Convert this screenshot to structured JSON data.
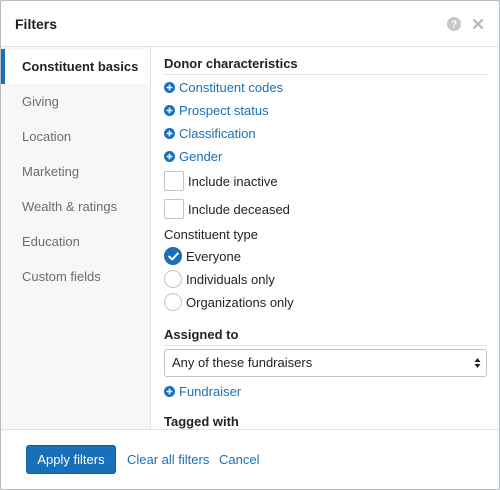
{
  "header": {
    "title": "Filters",
    "help_icon": "help-circle-icon",
    "close_icon": "close-icon"
  },
  "sidebar": {
    "items": [
      {
        "label": "Constituent basics",
        "active": true
      },
      {
        "label": "Giving"
      },
      {
        "label": "Location"
      },
      {
        "label": "Marketing"
      },
      {
        "label": "Wealth & ratings"
      },
      {
        "label": "Education"
      },
      {
        "label": "Custom fields"
      }
    ]
  },
  "content": {
    "donor_section_title": "Donor characteristics",
    "add_links": [
      {
        "label": "Constituent codes",
        "icon": "plus-circle-icon"
      },
      {
        "label": "Prospect status",
        "icon": "plus-circle-icon"
      },
      {
        "label": "Classification",
        "icon": "plus-circle-icon"
      },
      {
        "label": "Gender",
        "icon": "plus-circle-icon"
      }
    ],
    "checkboxes": [
      {
        "label": "Include inactive",
        "checked": false
      },
      {
        "label": "Include deceased",
        "checked": false
      }
    ],
    "constituent_type": {
      "label": "Constituent type",
      "options": [
        {
          "label": "Everyone",
          "selected": true
        },
        {
          "label": "Individuals only",
          "selected": false
        },
        {
          "label": "Organizations only",
          "selected": false
        }
      ]
    },
    "assigned_section_title": "Assigned to",
    "assigned_select_value": "Any of these fundraisers",
    "fundraiser_link": "Fundraiser",
    "tagged_section_title": "Tagged with"
  },
  "footer": {
    "apply_label": "Apply filters",
    "clear_label": "Clear all filters",
    "cancel_label": "Cancel"
  },
  "colors": {
    "accent": "#1870b8",
    "sidebar_bg": "#f7f7f8",
    "muted_text": "#686c73"
  }
}
